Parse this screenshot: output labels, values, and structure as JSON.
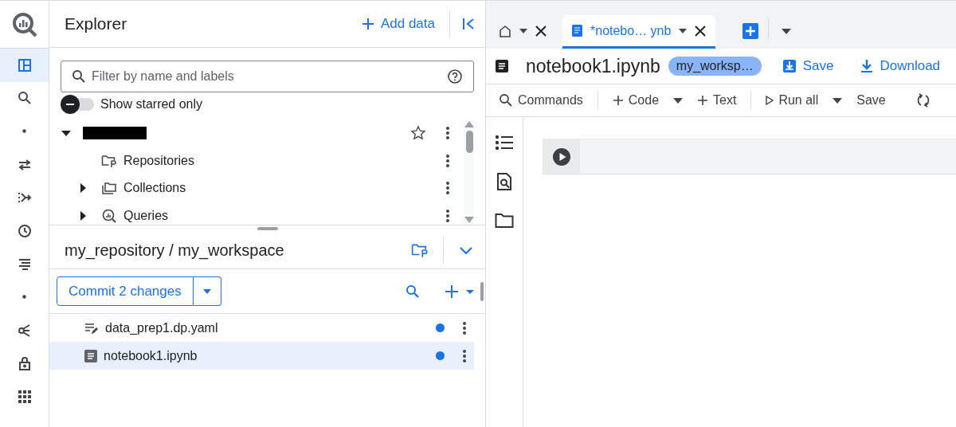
{
  "rail": {
    "items": [
      {
        "kind": "panels",
        "selected": true
      },
      {
        "kind": "search",
        "selected": false
      },
      {
        "kind": "dot",
        "selected": false
      },
      {
        "kind": "transfer",
        "selected": false
      },
      {
        "kind": "pipeline",
        "selected": false
      },
      {
        "kind": "clock",
        "selected": false
      },
      {
        "kind": "lines",
        "selected": false
      },
      {
        "kind": "dot",
        "selected": false
      },
      {
        "kind": "graph",
        "selected": false
      },
      {
        "kind": "lock",
        "selected": false
      },
      {
        "kind": "grid",
        "selected": false
      }
    ]
  },
  "explorer": {
    "title": "Explorer",
    "add_data": "Add data",
    "search": {
      "placeholder": "Filter by name and labels"
    },
    "starred_toggle": {
      "label": "Show starred only",
      "on": false
    },
    "tree": [
      {
        "expanded": true,
        "starred": false,
        "children": [
          {
            "label": "Repositories",
            "kind": "repo"
          },
          {
            "label": "Collections",
            "kind": "collections",
            "expanded": false
          },
          {
            "label": "Queries",
            "kind": "queries",
            "expanded": false
          }
        ]
      }
    ]
  },
  "workspace": {
    "path": "my_repository / my_workspace",
    "commit_button": "Commit 2 changes",
    "files": [
      {
        "name": "data_prep1.dp.yaml",
        "kind": "pipeline",
        "modified": true,
        "selected": false
      },
      {
        "name": "notebook1.ipynb",
        "kind": "notebook",
        "modified": true,
        "selected": true
      }
    ]
  },
  "tabs": [
    {
      "kind": "home",
      "selected": false
    },
    {
      "kind": "file",
      "label": "*notebo… ynb",
      "selected": true
    }
  ],
  "editor": {
    "title": "notebook1.ipynb",
    "workspace_badge": "my_worksp…",
    "save": "Save",
    "download": "Download",
    "toolbar": [
      {
        "kind": "commands",
        "label": "Commands"
      },
      {
        "kind": "add",
        "label": "Code",
        "menu": true
      },
      {
        "kind": "add",
        "label": "Text"
      },
      {
        "kind": "run",
        "label": "Run all",
        "menu": true
      },
      {
        "kind": "plain",
        "label": "Save"
      }
    ]
  }
}
